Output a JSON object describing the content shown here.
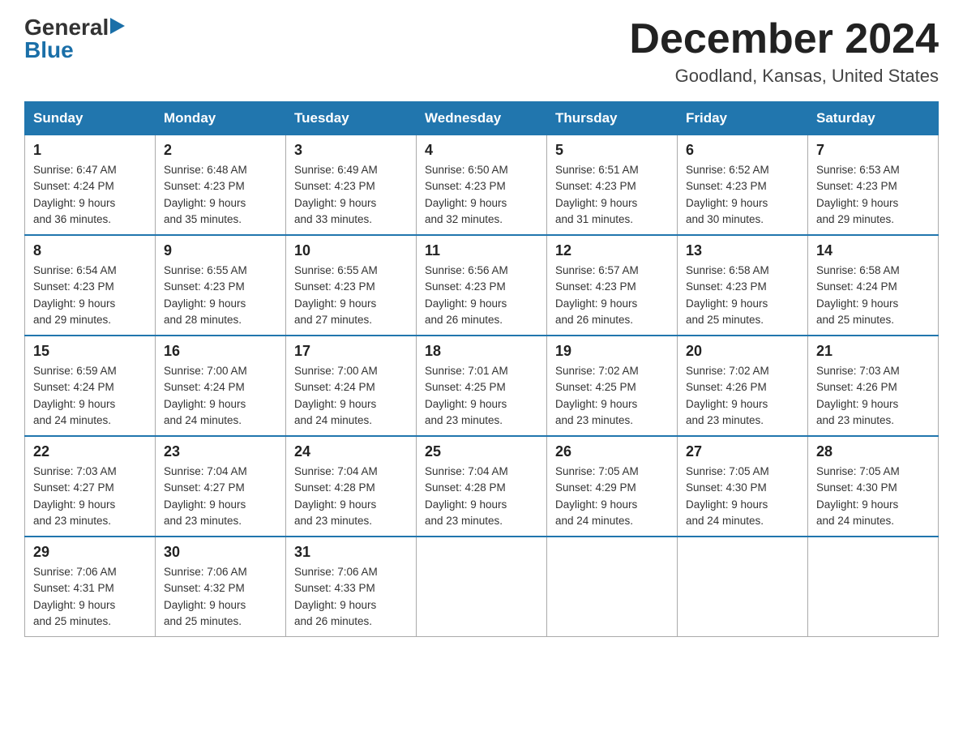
{
  "header": {
    "logo_general": "General",
    "logo_blue": "Blue",
    "month_title": "December 2024",
    "location": "Goodland, Kansas, United States"
  },
  "weekdays": [
    "Sunday",
    "Monday",
    "Tuesday",
    "Wednesday",
    "Thursday",
    "Friday",
    "Saturday"
  ],
  "weeks": [
    [
      {
        "day": "1",
        "sunrise": "6:47 AM",
        "sunset": "4:24 PM",
        "daylight": "9 hours and 36 minutes."
      },
      {
        "day": "2",
        "sunrise": "6:48 AM",
        "sunset": "4:23 PM",
        "daylight": "9 hours and 35 minutes."
      },
      {
        "day": "3",
        "sunrise": "6:49 AM",
        "sunset": "4:23 PM",
        "daylight": "9 hours and 33 minutes."
      },
      {
        "day": "4",
        "sunrise": "6:50 AM",
        "sunset": "4:23 PM",
        "daylight": "9 hours and 32 minutes."
      },
      {
        "day": "5",
        "sunrise": "6:51 AM",
        "sunset": "4:23 PM",
        "daylight": "9 hours and 31 minutes."
      },
      {
        "day": "6",
        "sunrise": "6:52 AM",
        "sunset": "4:23 PM",
        "daylight": "9 hours and 30 minutes."
      },
      {
        "day": "7",
        "sunrise": "6:53 AM",
        "sunset": "4:23 PM",
        "daylight": "9 hours and 29 minutes."
      }
    ],
    [
      {
        "day": "8",
        "sunrise": "6:54 AM",
        "sunset": "4:23 PM",
        "daylight": "9 hours and 29 minutes."
      },
      {
        "day": "9",
        "sunrise": "6:55 AM",
        "sunset": "4:23 PM",
        "daylight": "9 hours and 28 minutes."
      },
      {
        "day": "10",
        "sunrise": "6:55 AM",
        "sunset": "4:23 PM",
        "daylight": "9 hours and 27 minutes."
      },
      {
        "day": "11",
        "sunrise": "6:56 AM",
        "sunset": "4:23 PM",
        "daylight": "9 hours and 26 minutes."
      },
      {
        "day": "12",
        "sunrise": "6:57 AM",
        "sunset": "4:23 PM",
        "daylight": "9 hours and 26 minutes."
      },
      {
        "day": "13",
        "sunrise": "6:58 AM",
        "sunset": "4:23 PM",
        "daylight": "9 hours and 25 minutes."
      },
      {
        "day": "14",
        "sunrise": "6:58 AM",
        "sunset": "4:24 PM",
        "daylight": "9 hours and 25 minutes."
      }
    ],
    [
      {
        "day": "15",
        "sunrise": "6:59 AM",
        "sunset": "4:24 PM",
        "daylight": "9 hours and 24 minutes."
      },
      {
        "day": "16",
        "sunrise": "7:00 AM",
        "sunset": "4:24 PM",
        "daylight": "9 hours and 24 minutes."
      },
      {
        "day": "17",
        "sunrise": "7:00 AM",
        "sunset": "4:24 PM",
        "daylight": "9 hours and 24 minutes."
      },
      {
        "day": "18",
        "sunrise": "7:01 AM",
        "sunset": "4:25 PM",
        "daylight": "9 hours and 23 minutes."
      },
      {
        "day": "19",
        "sunrise": "7:02 AM",
        "sunset": "4:25 PM",
        "daylight": "9 hours and 23 minutes."
      },
      {
        "day": "20",
        "sunrise": "7:02 AM",
        "sunset": "4:26 PM",
        "daylight": "9 hours and 23 minutes."
      },
      {
        "day": "21",
        "sunrise": "7:03 AM",
        "sunset": "4:26 PM",
        "daylight": "9 hours and 23 minutes."
      }
    ],
    [
      {
        "day": "22",
        "sunrise": "7:03 AM",
        "sunset": "4:27 PM",
        "daylight": "9 hours and 23 minutes."
      },
      {
        "day": "23",
        "sunrise": "7:04 AM",
        "sunset": "4:27 PM",
        "daylight": "9 hours and 23 minutes."
      },
      {
        "day": "24",
        "sunrise": "7:04 AM",
        "sunset": "4:28 PM",
        "daylight": "9 hours and 23 minutes."
      },
      {
        "day": "25",
        "sunrise": "7:04 AM",
        "sunset": "4:28 PM",
        "daylight": "9 hours and 23 minutes."
      },
      {
        "day": "26",
        "sunrise": "7:05 AM",
        "sunset": "4:29 PM",
        "daylight": "9 hours and 24 minutes."
      },
      {
        "day": "27",
        "sunrise": "7:05 AM",
        "sunset": "4:30 PM",
        "daylight": "9 hours and 24 minutes."
      },
      {
        "day": "28",
        "sunrise": "7:05 AM",
        "sunset": "4:30 PM",
        "daylight": "9 hours and 24 minutes."
      }
    ],
    [
      {
        "day": "29",
        "sunrise": "7:06 AM",
        "sunset": "4:31 PM",
        "daylight": "9 hours and 25 minutes."
      },
      {
        "day": "30",
        "sunrise": "7:06 AM",
        "sunset": "4:32 PM",
        "daylight": "9 hours and 25 minutes."
      },
      {
        "day": "31",
        "sunrise": "7:06 AM",
        "sunset": "4:33 PM",
        "daylight": "9 hours and 26 minutes."
      },
      null,
      null,
      null,
      null
    ]
  ],
  "labels": {
    "sunrise": "Sunrise:",
    "sunset": "Sunset:",
    "daylight": "Daylight:"
  }
}
